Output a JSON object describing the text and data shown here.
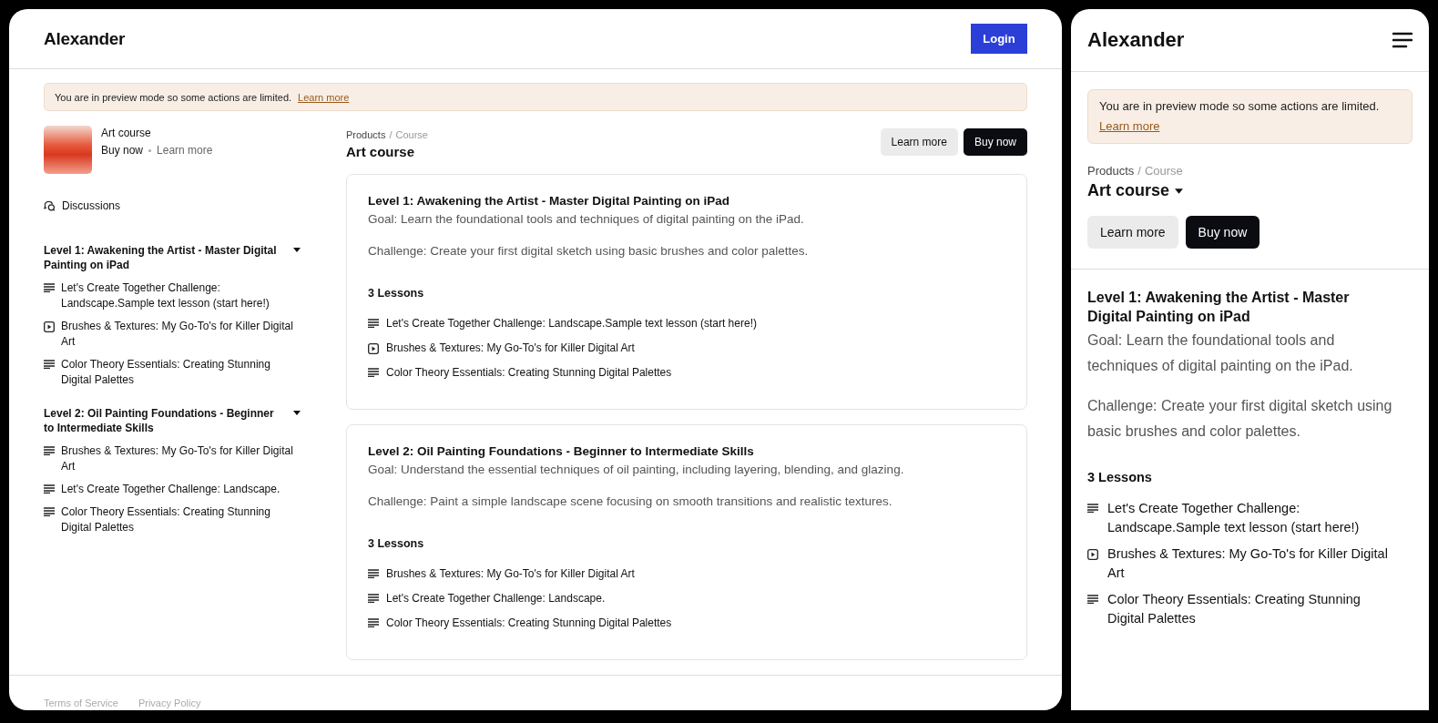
{
  "desktop": {
    "brand": "Alexander",
    "login": "Login",
    "banner": {
      "text": "You are in preview mode so some actions are limited.",
      "link": "Learn more"
    },
    "product": {
      "title": "Art course",
      "buy": "Buy now",
      "learn": "Learn more"
    },
    "discussions": "Discussions",
    "sidebar_levels": [
      {
        "title": "Level 1: Awakening the Artist - Master Digital Painting on iPad",
        "expanded": true,
        "lessons": [
          {
            "kind": "text",
            "title": "Let's Create Together Challenge: Landscape.Sample text lesson (start here!)"
          },
          {
            "kind": "video",
            "title": "Brushes & Textures: My Go-To's for Killer Digital Art"
          },
          {
            "kind": "text",
            "title": "Color Theory Essentials: Creating Stunning Digital Palettes"
          }
        ]
      },
      {
        "title": "Level 2: Oil Painting Foundations - Beginner to Intermediate Skills",
        "expanded": true,
        "lessons": [
          {
            "kind": "text",
            "title": "Brushes & Textures: My Go-To's for Killer Digital Art"
          },
          {
            "kind": "text",
            "title": "Let's Create Together Challenge: Landscape."
          },
          {
            "kind": "text",
            "title": "Color Theory Essentials: Creating Stunning Digital Palettes"
          }
        ]
      }
    ],
    "breadcrumb": [
      "Products",
      "/",
      "Course"
    ],
    "page_title": "Art course",
    "buttons": {
      "learn": "Learn more",
      "buy": "Buy now"
    },
    "cards": [
      {
        "title": "Level 1: Awakening the Artist - Master Digital Painting on iPad",
        "goal": "Goal: Learn the foundational tools and techniques of digital painting on the iPad.",
        "challenge": "Challenge: Create your first digital sketch using basic brushes and color palettes.",
        "lessons_count": "3 Lessons",
        "lessons": [
          {
            "kind": "text",
            "title": "Let's Create Together Challenge: Landscape.Sample text lesson (start here!)"
          },
          {
            "kind": "video",
            "title": "Brushes & Textures: My Go-To's for Killer Digital Art"
          },
          {
            "kind": "text",
            "title": "Color Theory Essentials: Creating Stunning Digital Palettes"
          }
        ]
      },
      {
        "title": "Level 2: Oil Painting Foundations - Beginner to Intermediate Skills",
        "goal": "Goal: Understand the essential techniques of oil painting, including layering, blending, and glazing.",
        "challenge": "Challenge: Paint a simple landscape scene focusing on smooth transitions and realistic textures.",
        "lessons_count": "3 Lessons",
        "lessons": [
          {
            "kind": "text",
            "title": "Brushes & Textures: My Go-To's for Killer Digital Art"
          },
          {
            "kind": "text",
            "title": "Let's Create Together Challenge: Landscape."
          },
          {
            "kind": "text",
            "title": "Color Theory Essentials: Creating Stunning Digital Palettes"
          }
        ]
      }
    ],
    "footer": [
      "Terms of Service",
      "Privacy Policy"
    ]
  },
  "mobile": {
    "brand": "Alexander",
    "banner": {
      "text": "You are in preview mode so some actions are limited.",
      "link": "Learn more"
    },
    "breadcrumb": [
      "Products",
      "/",
      "Course"
    ],
    "page_title": "Art course",
    "buttons": {
      "learn": "Learn more",
      "buy": "Buy now"
    },
    "card": {
      "title": "Level 1: Awakening the Artist - Master Digital Painting on iPad",
      "goal": "Goal: Learn the foundational tools and techniques of digital painting on the iPad.",
      "challenge": "Challenge: Create your first digital sketch using basic brushes and color palettes.",
      "lessons_count": "3 Lessons",
      "lessons": [
        {
          "kind": "text",
          "title": "Let's Create Together Challenge: Landscape.Sample text lesson (start here!)"
        },
        {
          "kind": "video",
          "title": "Brushes & Textures: My Go-To's for Killer Digital Art"
        },
        {
          "kind": "text",
          "title": "Color Theory Essentials: Creating Stunning Digital Palettes"
        }
      ]
    }
  }
}
